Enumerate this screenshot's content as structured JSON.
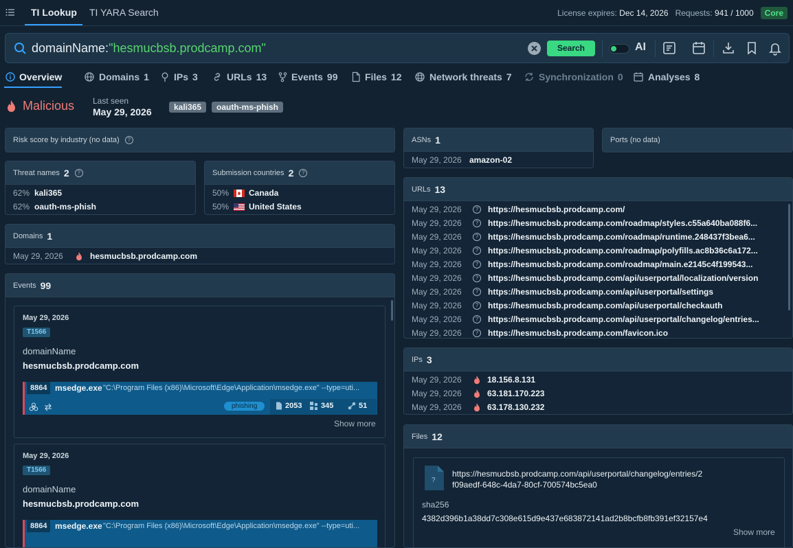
{
  "topbar": {
    "tabs": [
      "TI Lookup",
      "TI YARA Search"
    ],
    "license_label": "License expires:",
    "license_value": "Dec 14, 2026",
    "requests_label": "Requests:",
    "requests_value": "941 / 1000",
    "plan": "Core"
  },
  "search": {
    "key": "domainName:",
    "value": "\"hesmucbsb.prodcamp.com\"",
    "button": "Search",
    "ai_label": "AI"
  },
  "nav": {
    "tabs": [
      {
        "label": "Overview",
        "count": ""
      },
      {
        "label": "Domains",
        "count": "1"
      },
      {
        "label": "IPs",
        "count": "3"
      },
      {
        "label": "URLs",
        "count": "13"
      },
      {
        "label": "Events",
        "count": "99"
      },
      {
        "label": "Files",
        "count": "12"
      },
      {
        "label": "Network threats",
        "count": "7"
      },
      {
        "label": "Synchronization",
        "count": "0"
      },
      {
        "label": "Analyses",
        "count": "8"
      }
    ]
  },
  "summary": {
    "verdict": "Malicious",
    "last_seen_label": "Last seen",
    "last_seen_value": "May 29, 2026",
    "tags": [
      "kali365",
      "oauth-ms-phish"
    ]
  },
  "risk": {
    "title": "Risk score by industry (no data)"
  },
  "threat_names": {
    "title": "Threat names",
    "count": "2",
    "rows": [
      {
        "pct": "62%",
        "name": "kali365"
      },
      {
        "pct": "62%",
        "name": "oauth-ms-phish"
      }
    ]
  },
  "countries": {
    "title": "Submission countries",
    "count": "2",
    "rows": [
      {
        "pct": "50%",
        "name": "Canada",
        "flag": "canada-flag"
      },
      {
        "pct": "50%",
        "name": "United States",
        "flag": "us-flag"
      }
    ]
  },
  "domains": {
    "title": "Domains",
    "count": "1",
    "rows": [
      {
        "date": "May 29, 2026",
        "name": "hesmucbsb.prodcamp.com"
      }
    ]
  },
  "events": {
    "title": "Events",
    "count": "99",
    "items": [
      {
        "date": "May 29, 2026",
        "technique": "T1566",
        "field": "domainName",
        "value": "hesmucbsb.prodcamp.com",
        "pid": "8864",
        "process": "msedge.exe",
        "cmd": "\"C:\\Program Files (x86)\\Microsoft\\Edge\\Application\\msedge.exe\" --type=uti...",
        "tag": "phishing",
        "files": "2053",
        "registry": "345",
        "network": "51",
        "show_more": "Show more"
      },
      {
        "date": "May 29, 2026",
        "technique": "T1566",
        "field": "domainName",
        "value": "hesmucbsb.prodcamp.com",
        "pid": "8864",
        "process": "msedge.exe",
        "cmd": "\"C:\\Program Files (x86)\\Microsoft\\Edge\\Application\\msedge.exe\" --type=uti..."
      }
    ]
  },
  "asns": {
    "title": "ASNs",
    "count": "1",
    "rows": [
      {
        "date": "May 29, 2026",
        "name": "amazon-02"
      }
    ]
  },
  "ports": {
    "title": "Ports (no data)"
  },
  "urls": {
    "title": "URLs",
    "count": "13",
    "rows": [
      {
        "date": "May 29, 2026",
        "url": "https://hesmucbsb.prodcamp.com/"
      },
      {
        "date": "May 29, 2026",
        "url": "https://hesmucbsb.prodcamp.com/roadmap/styles.c55a640ba088f6..."
      },
      {
        "date": "May 29, 2026",
        "url": "https://hesmucbsb.prodcamp.com/roadmap/runtime.248437f3bea6..."
      },
      {
        "date": "May 29, 2026",
        "url": "https://hesmucbsb.prodcamp.com/roadmap/polyfills.ac8b36c6a172..."
      },
      {
        "date": "May 29, 2026",
        "url": "https://hesmucbsb.prodcamp.com/roadmap/main.e2145c4f199543..."
      },
      {
        "date": "May 29, 2026",
        "url": "https://hesmucbsb.prodcamp.com/api/userportal/localization/version"
      },
      {
        "date": "May 29, 2026",
        "url": "https://hesmucbsb.prodcamp.com/api/userportal/settings"
      },
      {
        "date": "May 29, 2026",
        "url": "https://hesmucbsb.prodcamp.com/api/userportal/checkauth"
      },
      {
        "date": "May 29, 2026",
        "url": "https://hesmucbsb.prodcamp.com/api/userportal/changelog/entries..."
      },
      {
        "date": "May 29, 2026",
        "url": "https://hesmucbsb.prodcamp.com/favicon.ico"
      }
    ]
  },
  "ips": {
    "title": "IPs",
    "count": "3",
    "rows": [
      {
        "date": "May 29, 2026",
        "ip": "18.156.8.131"
      },
      {
        "date": "May 29, 2026",
        "ip": "63.181.170.223"
      },
      {
        "date": "May 29, 2026",
        "ip": "63.178.130.232"
      }
    ]
  },
  "files": {
    "title": "Files",
    "count": "12",
    "item": {
      "url_line1": "https://hesmucbsb.prodcamp.com/api/userportal/changelog/entries/2",
      "url_line2": "f09aedf-648c-4da7-80cf-700574bc5ea0",
      "hash_label": "sha256",
      "hash": "4382d396b1a38dd7c308e615d9e437e683872141ad2b8bcfb8fb391ef32157e4",
      "show_more": "Show more"
    }
  },
  "colors": {
    "accent": "#36a1ff",
    "malicious": "#f07c78",
    "search_button": "#39d882",
    "core": "#4fe08a"
  }
}
